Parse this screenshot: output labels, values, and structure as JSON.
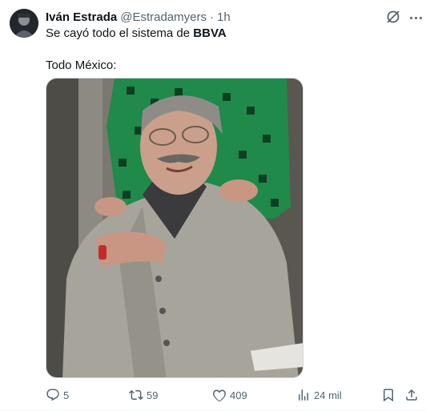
{
  "author": {
    "name": "Iván Estrada",
    "handle": "@Estradamyers",
    "separator": "·",
    "time": "1h"
  },
  "tweet": {
    "line1_prefix": "Se cayó todo el sistema de ",
    "line1_bold": "BBVA",
    "line2": "Todo México:"
  },
  "actions": {
    "replies": "5",
    "retweets": "59",
    "likes": "409",
    "views": "24 mil"
  },
  "icons": {
    "grok": "grok-icon",
    "more": "more-icon",
    "reply": "reply-icon",
    "retweet": "retweet-icon",
    "like": "heart-icon",
    "views": "views-icon",
    "bookmark": "bookmark-icon",
    "share": "share-icon"
  },
  "colors": {
    "text": "#0f1419",
    "secondary": "#536471",
    "border": "#cfd9de"
  }
}
